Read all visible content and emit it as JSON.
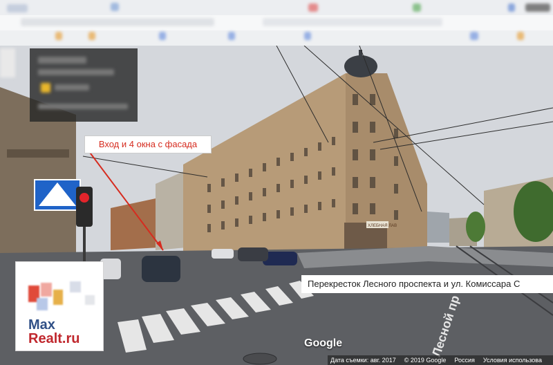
{
  "annotation": {
    "text": "Вход и 4 окна с фасада"
  },
  "street_view": {
    "address_label": "Перекресток Лесного проспекта и ул. Комиссара С",
    "google_logo": "Google",
    "footer": {
      "capture_date": "Дата съемки: авг. 2017",
      "copyright": "© 2019 Google",
      "country": "Россия",
      "terms": "Условия использова"
    },
    "street_sign": "Лесной пр",
    "shop_sign": "ХЛЕБНАЯ ЛАВ"
  },
  "watermark": {
    "line1": "Max",
    "line2": "Realt.ru"
  },
  "colors": {
    "annotation_text": "#d62b1f",
    "sky": "#d4d7dc",
    "building": "#b79b78",
    "road": "#5d5f63"
  }
}
